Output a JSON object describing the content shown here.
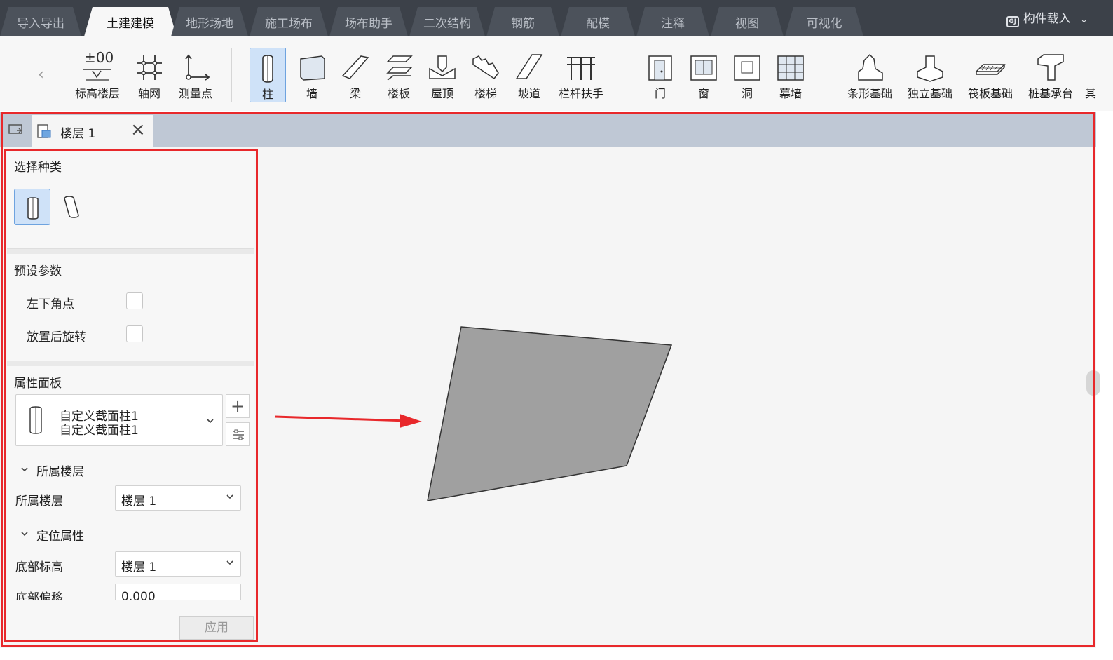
{
  "top_tabs": [
    "导入导出",
    "土建建模",
    "地形场地",
    "施工场布",
    "场布助手",
    "二次结构",
    "钢筋",
    "配模",
    "注释",
    "视图",
    "可视化"
  ],
  "active_tab": "土建建模",
  "component_load": {
    "badge": "GJ",
    "label": "构件载入"
  },
  "ribbon": {
    "group1": [
      "标高楼层",
      "轴网",
      "测量点"
    ],
    "group1_top_text": "±00",
    "group2": [
      "柱",
      "墙",
      "梁",
      "楼板",
      "屋顶",
      "楼梯",
      "坡道",
      "栏杆扶手"
    ],
    "group3": [
      "门",
      "窗",
      "洞",
      "幕墙"
    ],
    "group4": [
      "条形基础",
      "独立基础",
      "筏板基础",
      "桩基承台",
      "其"
    ],
    "selected": "柱"
  },
  "document_tab": {
    "label": "楼层 1"
  },
  "left_panel": {
    "select_type_title": "选择种类",
    "preset_title": "预设参数",
    "preset_items": [
      "左下角点",
      "放置后旋转"
    ],
    "property_title": "属性面板",
    "component": {
      "line1": "自定义截面柱1",
      "line2": "自定义截面柱1"
    },
    "group_floor": {
      "title": "所属楼层",
      "label": "所属楼层",
      "value": "楼层 1"
    },
    "group_position": {
      "title": "定位属性",
      "bottom_elev_label": "底部标高",
      "bottom_elev_value": "楼层 1",
      "bottom_offset_label": "底部偏移",
      "bottom_offset_value": "0.000"
    },
    "apply_label": "应用"
  },
  "colors": {
    "tabbar": "#3c4149",
    "ribbon_bg": "#f7f7f7",
    "selection": "#cfe2f8",
    "highlight": "#e8282b",
    "shape_fill": "#a0a0a0"
  }
}
